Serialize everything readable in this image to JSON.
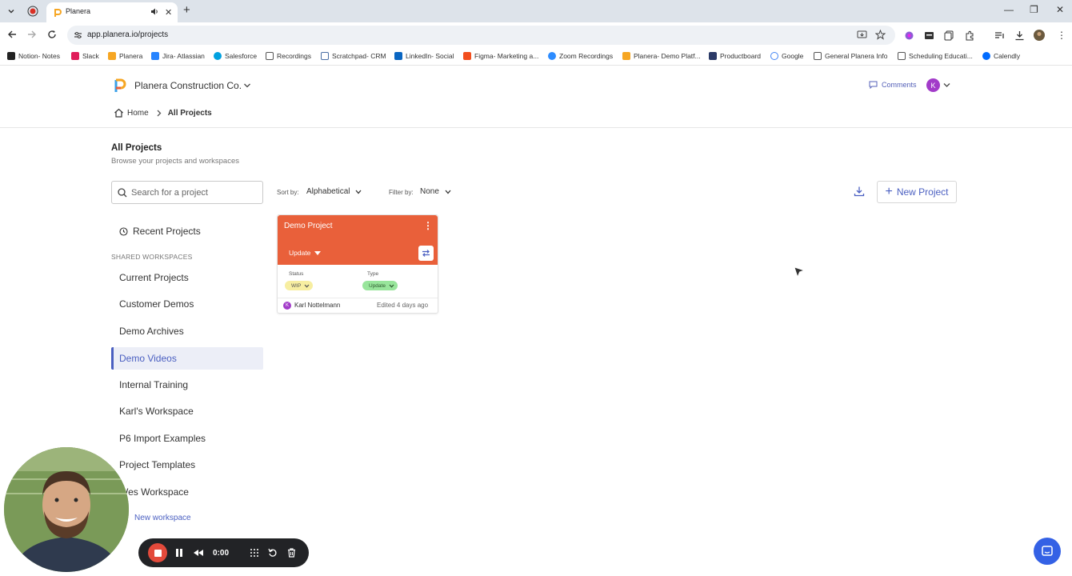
{
  "browser": {
    "tab_title": "Planera",
    "url": "app.planera.io/projects",
    "bookmarks": [
      {
        "label": "Notion- Notes",
        "color": "#222222"
      },
      {
        "label": "Slack",
        "color": "#e01e5a"
      },
      {
        "label": "Planera",
        "color": "#f6a623"
      },
      {
        "label": "Jira- Atlassian",
        "color": "#2684ff"
      },
      {
        "label": "Salesforce",
        "color": "#00a1e0"
      },
      {
        "label": "Recordings",
        "color": "#555555"
      },
      {
        "label": "Scratchpad- CRM",
        "color": "#4a6fa5"
      },
      {
        "label": "LinkedIn- Social",
        "color": "#0a66c2"
      },
      {
        "label": "Figma- Marketing a...",
        "color": "#f24e1e"
      },
      {
        "label": "Zoom Recordings",
        "color": "#2d8cff"
      },
      {
        "label": "Planera- Demo Platf...",
        "color": "#f6a623"
      },
      {
        "label": "Productboard",
        "color": "#2b3a67"
      },
      {
        "label": "Google",
        "color": "#4285f4"
      },
      {
        "label": "General Planera Info",
        "color": "#555555"
      },
      {
        "label": "Scheduling Educati...",
        "color": "#555555"
      },
      {
        "label": "Calendly",
        "color": "#006bff"
      }
    ]
  },
  "header": {
    "company": "Planera Construction Co.",
    "comments_label": "Comments",
    "user_initial": "K"
  },
  "breadcrumb": {
    "home": "Home",
    "current": "All Projects"
  },
  "page": {
    "title": "All Projects",
    "subtitle": "Browse your projects and workspaces"
  },
  "toolbar": {
    "search_placeholder": "Search for a project",
    "sort_label": "Sort by:",
    "sort_value": "Alphabetical",
    "filter_label": "Filter by:",
    "filter_value": "None",
    "new_project_label": "New Project"
  },
  "sidebar": {
    "recent_label": "Recent Projects",
    "shared_label": "SHARED WORKSPACES",
    "workspaces": [
      {
        "label": "Current Projects",
        "active": false
      },
      {
        "label": "Customer Demos",
        "active": false
      },
      {
        "label": "Demo Archives",
        "active": false
      },
      {
        "label": "Demo Videos",
        "active": true
      },
      {
        "label": "Internal Training",
        "active": false
      },
      {
        "label": "Karl's Workspace",
        "active": false
      },
      {
        "label": "P6 Import Examples",
        "active": false
      },
      {
        "label": "Project Templates",
        "active": false
      },
      {
        "label": "Wes Workspace",
        "active": false
      }
    ],
    "new_workspace_label": "New workspace"
  },
  "project_card": {
    "name": "Demo Project",
    "update_label": "Update",
    "status_label": "Status",
    "status_value": "WIP",
    "type_label": "Type",
    "type_value": "Update",
    "owner_initial": "K",
    "owner": "Karl Nottelmann",
    "edited": "Edited 4 days ago",
    "color": "#e9603a"
  },
  "recorder": {
    "timer": "0:00"
  },
  "colors": {
    "accent": "#4a5fc1",
    "card": "#e9603a",
    "avatar": "#a23bc9",
    "stop": "#e34a3b",
    "chat": "#3461e5"
  }
}
